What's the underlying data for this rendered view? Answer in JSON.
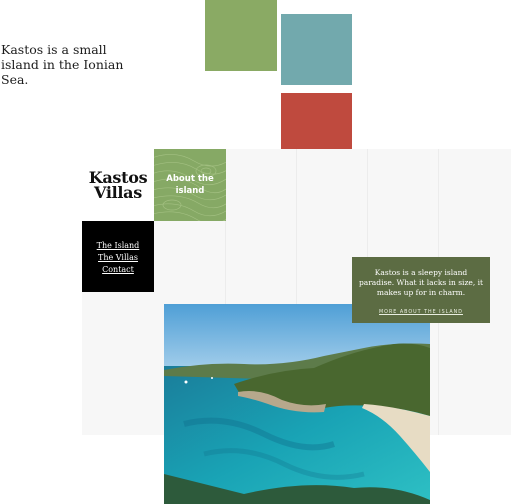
{
  "intro": {
    "text": "Kastos is a small island in the Ionian Sea."
  },
  "colors": {
    "green": "#8aaa64",
    "teal": "#72a9ad",
    "red": "#bf4a3e",
    "olive": "#5c6c43",
    "black": "#000000"
  },
  "logo": {
    "line1": "Kastos",
    "line2": "Villas"
  },
  "about": {
    "label": "About the island"
  },
  "nav": {
    "items": [
      {
        "label": "The Island"
      },
      {
        "label": "The Villas"
      },
      {
        "label": "Contact"
      }
    ]
  },
  "info_card": {
    "text": "Kastos is a sleepy island paradise. What it lacks in size, it makes up for in charm.",
    "link": "MORE ABOUT THE ISLAND"
  },
  "photo": {
    "subject": "bay-with-turquoise-water-and-beach"
  }
}
